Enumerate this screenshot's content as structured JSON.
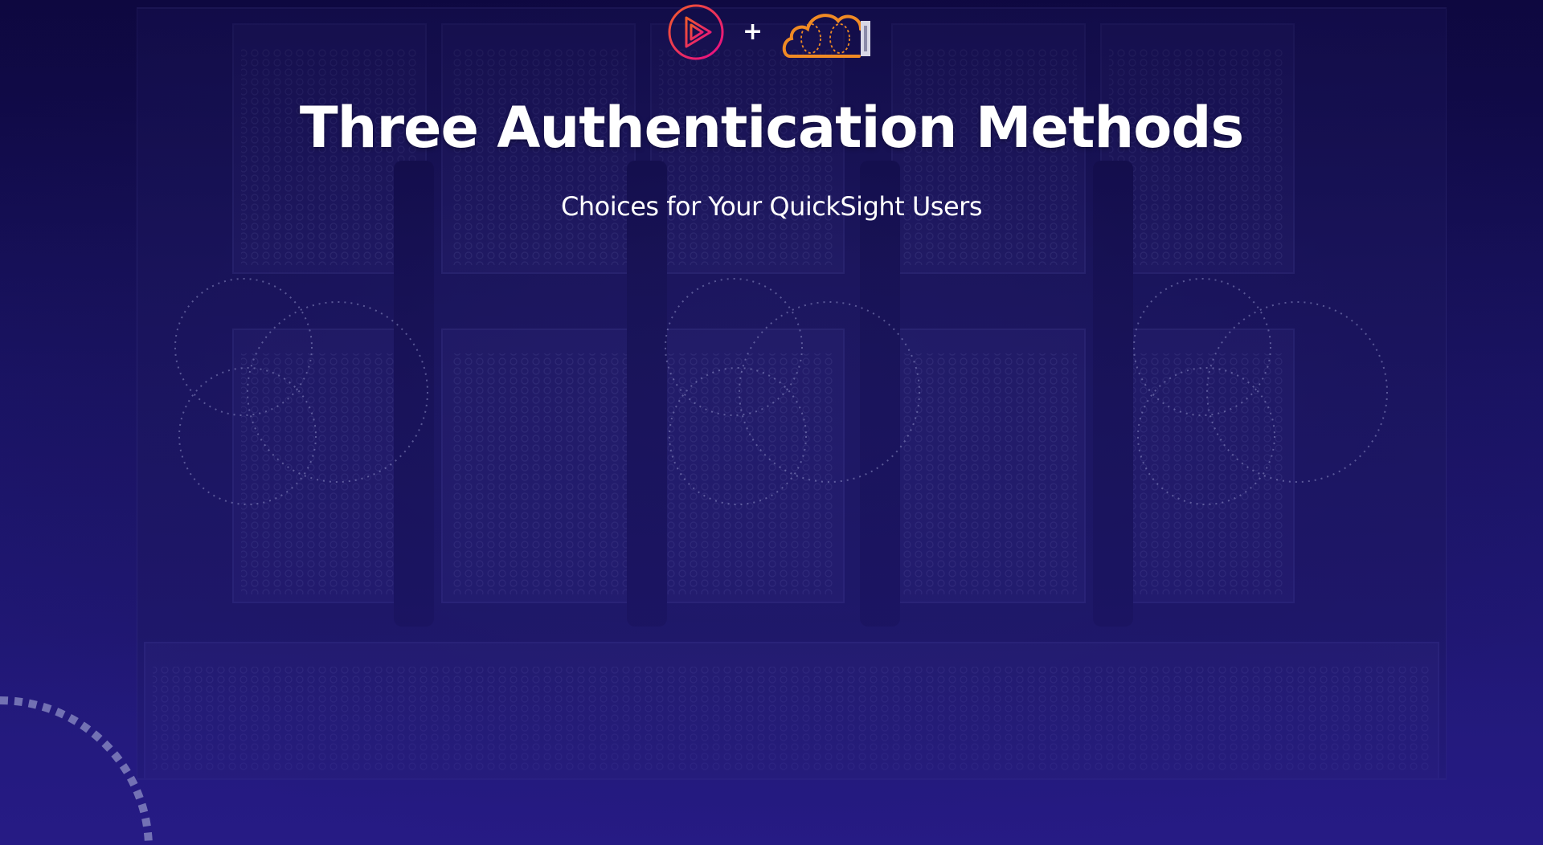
{
  "slide": {
    "title": "Three Authentication Methods",
    "subtitle": "Choices for Your QuickSight Users",
    "plus": "+"
  },
  "logos": {
    "left": "pluralsight-play-icon",
    "right": "aws-quicksight-cloud-icon"
  },
  "colors": {
    "background_top": "#0e0840",
    "background_bottom": "#261b85",
    "pluralsight_pink": "#e8265e",
    "aws_orange": "#f08a24",
    "text": "#ffffff"
  }
}
